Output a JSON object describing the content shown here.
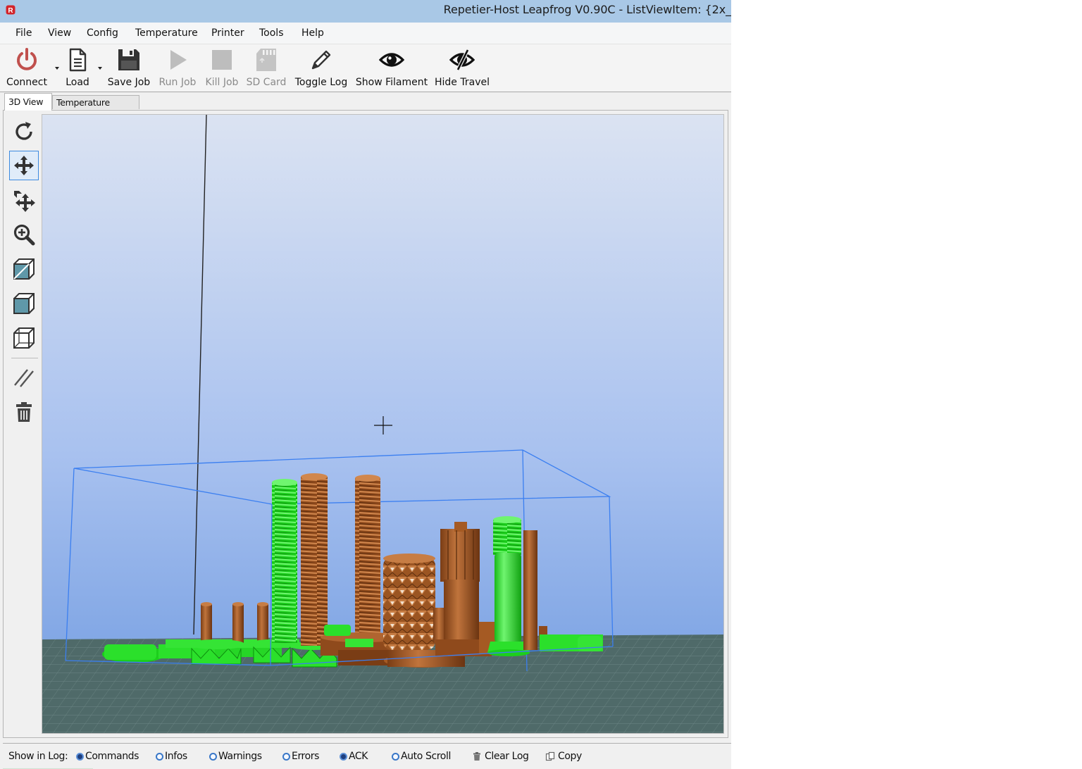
{
  "window": {
    "title": "Repetier-Host Leapfrog V0.90C - ListViewItem: {2x_"
  },
  "menu": [
    "File",
    "View",
    "Config",
    "Temperature",
    "Printer",
    "Tools",
    "Help"
  ],
  "toolbar": {
    "connect": "Connect",
    "load": "Load",
    "save_job": "Save Job",
    "run_job": "Run Job",
    "kill_job": "Kill Job",
    "sd_card": "SD Card",
    "toggle_log": "Toggle Log",
    "show_filament": "Show Filament",
    "hide_travel": "Hide Travel"
  },
  "tabs": {
    "view3d": "3D View",
    "temperature_curve": "Temperature Curve",
    "active": "3D View"
  },
  "view_tools": {
    "icons": [
      "reset-view-icon",
      "move-icon",
      "move-object-icon",
      "zoom-icon",
      "iso-view-icon",
      "front-view-icon",
      "wireframe-icon",
      "clear-travel-icon",
      "trash-icon"
    ],
    "selected": "move-icon"
  },
  "log": {
    "show_in_log": "Show in Log:",
    "commands": "Commands",
    "infos": "Infos",
    "warnings": "Warnings",
    "errors": "Errors",
    "ack": "ACK",
    "auto_scroll": "Auto Scroll",
    "clear_log": "Clear Log",
    "copy": "Copy",
    "checked": [
      "Commands",
      "ACK"
    ]
  },
  "colors": {
    "titlebar": "#a9c8e6",
    "sky_top": "#dbe3f2",
    "sky_bottom": "#6f9ae0",
    "floor": "#4f6a69",
    "filament_green": "#2be02b",
    "filament_brown": "#a55a23",
    "bed_outline": "#3b7ff0",
    "connect_red": "#c0504d"
  }
}
